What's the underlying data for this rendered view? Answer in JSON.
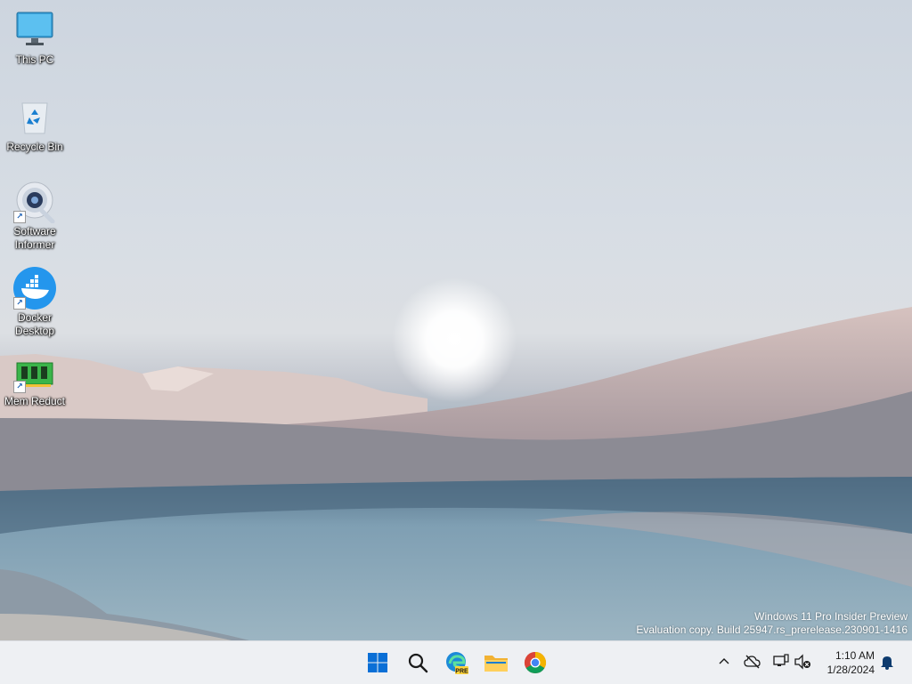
{
  "desktop_icons": [
    {
      "label": "This PC",
      "icon": "monitor-icon",
      "shortcut": false
    },
    {
      "label": "Recycle Bin",
      "icon": "recycle-bin-icon",
      "shortcut": false
    },
    {
      "label": "Software Informer",
      "icon": "software-informer-icon",
      "shortcut": true
    },
    {
      "label": "Docker Desktop",
      "icon": "docker-whale-icon",
      "shortcut": true
    },
    {
      "label": "Mem Reduct",
      "icon": "memory-chip-icon",
      "shortcut": true
    }
  ],
  "watermark": {
    "line1": "Windows 11 Pro Insider Preview",
    "line2": "Evaluation copy. Build 25947.rs_prerelease.230901-1416"
  },
  "taskbar": {
    "apps": [
      {
        "name": "Start",
        "icon": "windows-start-icon"
      },
      {
        "name": "Search",
        "icon": "search-icon"
      },
      {
        "name": "Microsoft Edge Canary",
        "icon": "edge-pre-icon",
        "badge": "PRE"
      },
      {
        "name": "File Explorer",
        "icon": "folder-icon"
      },
      {
        "name": "Google Chrome",
        "icon": "chrome-icon"
      }
    ],
    "tray": {
      "icons": [
        "chevron-up-icon",
        "cloud-off-icon",
        "network-icon",
        "volume-muted-icon"
      ],
      "time": "1:10 AM",
      "date": "1/28/2024",
      "notification_icon": "bell-icon"
    }
  }
}
